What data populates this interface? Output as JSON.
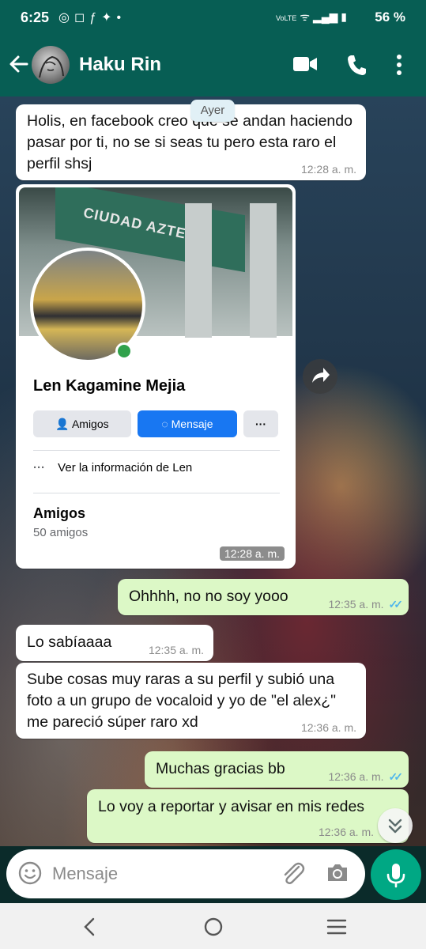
{
  "status_bar": {
    "time": "6:25",
    "left_icons": [
      "whatsapp-icon",
      "instagram-icon",
      "facebook-icon",
      "twitter-icon",
      "dot-icon"
    ],
    "network": "VoLTE",
    "battery_percent": "56 %"
  },
  "header": {
    "contact_name": "Haku Rin",
    "accent_color": "#075e54"
  },
  "chat": {
    "date_chip": "Ayer",
    "messages": [
      {
        "direction": "in",
        "text": "Holis, en facebook creo que se andan haciendo pasar por ti, no se si seas tu pero esta raro el perfil shsj",
        "time": "12:28 a. m."
      },
      {
        "direction": "in",
        "type": "image",
        "time": "12:28 a. m."
      },
      {
        "direction": "out",
        "text": "Ohhhh, no no soy yooo",
        "time": "12:35 a. m.",
        "status": "read"
      },
      {
        "direction": "in",
        "text": "Lo sabíaaaa",
        "time": "12:35 a. m."
      },
      {
        "direction": "in",
        "text": "Sube cosas muy raras a su perfil y subió una foto a un grupo de vocaloid y yo de \"el alex¿\" me pareció súper raro xd",
        "time": "12:36 a. m."
      },
      {
        "direction": "out",
        "text": "Muchas gracias bb",
        "time": "12:36 a. m.",
        "status": "read"
      },
      {
        "direction": "out",
        "text": "Lo voy a reportar y avisar en mis redes",
        "time": "12:36 a. m."
      }
    ]
  },
  "fb_card": {
    "cover_sign": "CIUDAD AZTECA",
    "name": "Len Kagamine Mejia",
    "btn_friends": "Amigos",
    "btn_message": "Mensaje",
    "btn_more": "···",
    "info_link": "Ver la información de Len",
    "friends_title": "Amigos",
    "friends_count": "50 amigos",
    "fb_blue": "#1877f2"
  },
  "input": {
    "placeholder": "Mensaje"
  },
  "colors": {
    "outgoing_bubble": "#dcf8c6",
    "incoming_bubble": "#ffffff",
    "read_ticks": "#4fb6ec",
    "mic_button": "#00a884"
  }
}
